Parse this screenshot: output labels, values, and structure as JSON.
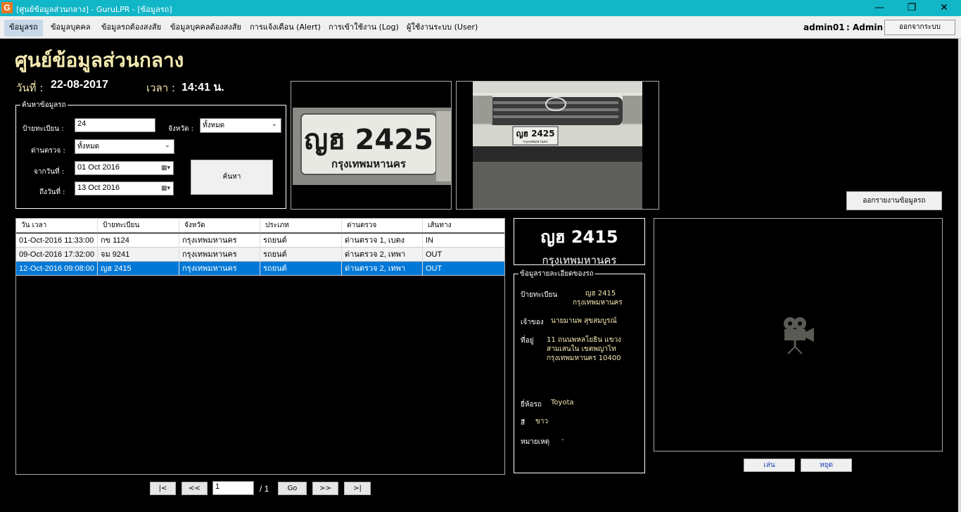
{
  "titlebar": {
    "app_icon": "G",
    "title": "[ศูนย์ข้อมูลส่วนกลาง] - GuruLPR - [ข้อมูลรถ]",
    "minimize": "—",
    "restore": "❐",
    "close": "✕"
  },
  "menu": {
    "items": [
      "ข้อมูลรถ",
      "ข้อมูลบุคคล",
      "ข้อมูลรถต้องสงสัย",
      "ข้อมูลบุคคลต้องสงสัย",
      "การแจ้งเตือน (Alert)",
      "การเข้าใช้งาน (Log)",
      "ผู้ใช้งานระบบ (User)"
    ],
    "active": "ข้อมูลรถ",
    "username": "admin01",
    "role": ": Admin",
    "logout": "ออกจากระบบ"
  },
  "header": {
    "title": "ศูนย์ข้อมูลส่วนกลาง",
    "date_label": "วันที่ :",
    "date_value": "22-08-2017",
    "time_label": "เวลา :",
    "time_value": "14:41 น."
  },
  "search": {
    "legend": "ค้นหาข้อมูลรถ",
    "plate_label": "ป้ายทะเบียน :",
    "plate_value": "24",
    "province_label": "จังหวัด :",
    "province_value": "ทั้งหมด",
    "checkpoint_label": "ด่านตรวจ :",
    "checkpoint_value": "ทั้งหมด",
    "from_label": "จากวันที่ :",
    "from_value": "01 Oct  2016",
    "to_label": "ถึงวันที่ :",
    "to_value": "13 Oct  2016",
    "search_button": "ค้นหา"
  },
  "images": {
    "plate_crop_line1": "ญฮ 2425",
    "plate_crop_line2": "กรุงเทพมหานคร",
    "car_plate_line1": "ญฮ 2425",
    "car_plate_line2": "กรุงเทพมหานคร"
  },
  "report_button": "ออกรายงานข้อมูลรถ",
  "table": {
    "columns": [
      "วัน เวลา",
      "ป้ายทะเบียน",
      "จังหวัด",
      "ประเภท",
      "ด่านตรวจ",
      "เส้นทาง"
    ],
    "rows": [
      [
        "01-Oct-2016 11:33:00",
        "กข 1124",
        "กรุงเทพมหานคร",
        "รถยนต์",
        "ด่านตรวจ 1, เบตง",
        "IN"
      ],
      [
        "09-Oct-2016 17:32:00",
        "จม 9241",
        "กรุงเทพมหานคร",
        "รถยนต์",
        "ด่านตรวจ 2, เทพา",
        "OUT"
      ],
      [
        "12-Oct-2016 09:08:00",
        "ญฮ 2415",
        "กรุงเทพมหานคร",
        "รถยนต์",
        "ด่านตรวจ 2, เทพา",
        "OUT"
      ]
    ],
    "selected_row": 2
  },
  "pager": {
    "first": "|<",
    "prev": "<<",
    "page": "1",
    "of": "/ 1",
    "go": "Go",
    "next": ">>",
    "last": ">|"
  },
  "plate_display": {
    "plate": "ญฮ 2415",
    "province": "กรุงเทพมหานคร"
  },
  "details": {
    "legend": "ข้อมูลรายละเอียดของรถ",
    "plate_label": "ป้ายทะเบียน",
    "plate_line1": "ญฮ 2415",
    "plate_line2": "กรุงเทพมหานคร",
    "owner_label": "เจ้าของ",
    "owner_value": "นายมานพ สุขสมบูรณ์",
    "address_label": "ที่อยู่",
    "address_line1": "11 ถนนพหลโยธิน แขวง",
    "address_line2": "สามเสนใน เขตพญาไท",
    "address_line3": "กรุงเทพมหานคร 10400",
    "brand_label": "ยี่ห้อรถ",
    "brand_value": "Toyota",
    "color_label": "สี",
    "color_value": "ขาว",
    "note_label": "หมายเหตุ",
    "note_value": "-"
  },
  "video": {
    "icon": "video-camera-icon",
    "play": "เล่น",
    "stop": "หยุด"
  }
}
